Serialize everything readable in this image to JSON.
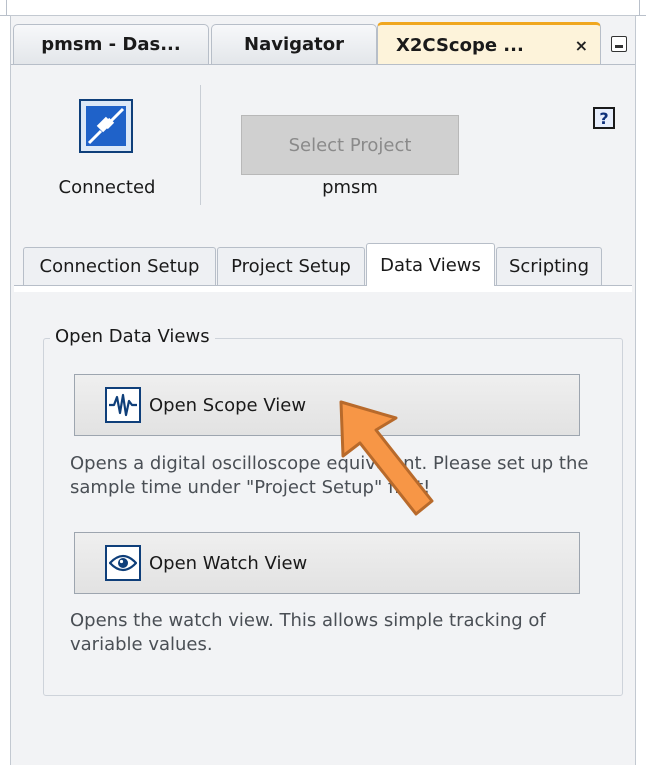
{
  "window_tabs": {
    "tab1": "pmsm - Das...",
    "tab2": "Navigator",
    "tab3": "X2CScope ...",
    "close_glyph": "×"
  },
  "header": {
    "connection_icon": "plug-connected-icon",
    "status": "Connected",
    "select_project_label": "Select Project",
    "project_name": "pmsm",
    "help_glyph": "?"
  },
  "sub_tabs": {
    "connection_setup": "Connection Setup",
    "project_setup": "Project Setup",
    "data_views": "Data Views",
    "scripting": "Scripting"
  },
  "data_views": {
    "group_title": "Open Data Views",
    "scope_button": "Open Scope View",
    "scope_description": "Opens a digital oscilloscope equivalent. Please set up the sample time under \"Project Setup\" first!",
    "watch_button": "Open Watch View",
    "watch_description": "Opens the watch view. This allows simple tracking of variable values."
  },
  "colors": {
    "accent_tab": "#f0a71f",
    "icon_blue": "#1f62c9",
    "arrow_fill": "#f79646",
    "arrow_stroke": "#b86a2b"
  }
}
